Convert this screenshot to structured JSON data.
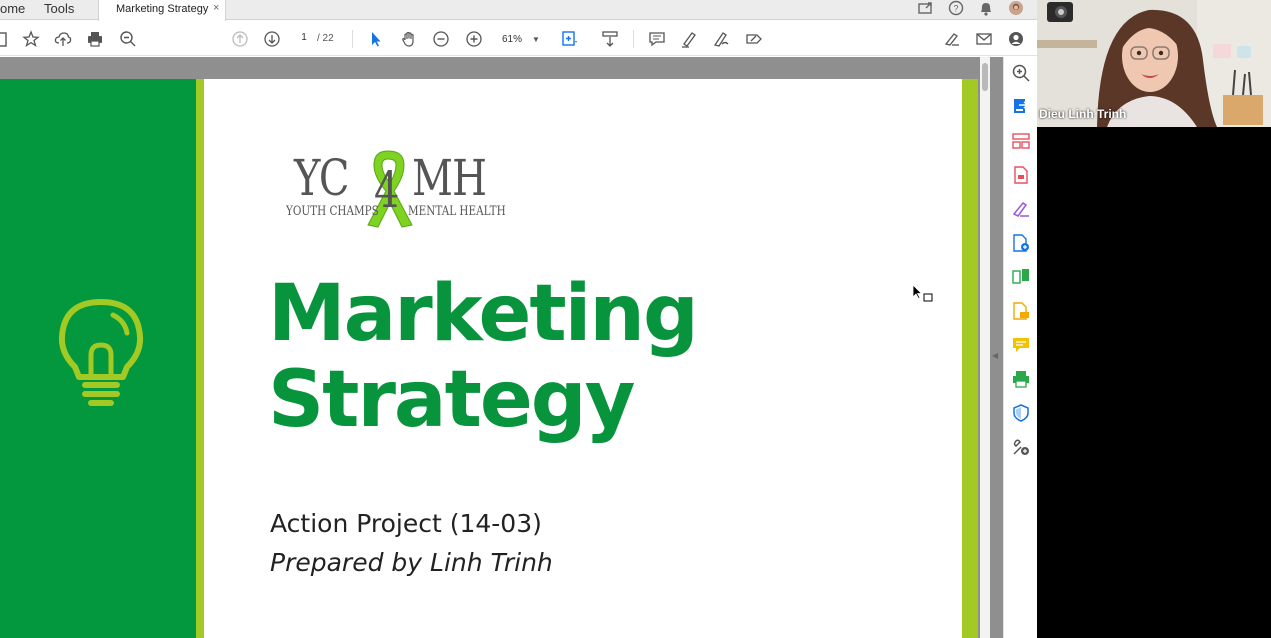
{
  "tabs": {
    "home_label": "ome",
    "tools_label": "Tools",
    "document_tab_title": "Marketing Strategy",
    "close_glyph": "×"
  },
  "toolbar": {
    "page_current": "1",
    "page_total": "/ 22",
    "zoom_value": "61%"
  },
  "document": {
    "logo_left": "YC",
    "logo_middle": "4",
    "logo_right": "MH",
    "logo_tagline_left": "YOUTH CHAMPS",
    "logo_tagline_right": "MENTAL HEALTH",
    "title_line1": "Marketing",
    "title_line2": "Strategy",
    "subtitle": "Action Project (14-03)",
    "prepared_by": "Prepared by Linh Trinh"
  },
  "participant": {
    "name": "Dieu Linh Trinh"
  },
  "colors": {
    "primary_green": "#04983e",
    "title_green": "#08943c",
    "lime_accent": "#a2c924",
    "acrobat_blue": "#1473e6"
  },
  "icons": {
    "left_toolbar": [
      "bookmark-icon",
      "star-icon",
      "upload-icon",
      "print-icon",
      "zoom-out-icon"
    ],
    "navigation": [
      "page-up-icon",
      "page-down-icon"
    ],
    "tools": [
      "select-pointer-icon",
      "hand-icon",
      "minus-circle-icon",
      "plus-circle-icon",
      "page-fit-icon",
      "scroll-mode-icon",
      "comment-icon",
      "highlight-icon",
      "draw-icon",
      "edit-sign-icon"
    ],
    "right_toolbar": [
      "sign-icon",
      "email-icon",
      "account-icon"
    ],
    "right_panel": [
      "zoom-icon",
      "export-pdf-icon",
      "organize-pages-icon",
      "create-pdf-icon",
      "fill-sign-icon",
      "edit-pdf-icon",
      "combine-files-icon",
      "export-icon",
      "comment-tool-icon",
      "scan-icon",
      "protect-icon",
      "more-tools-icon"
    ]
  }
}
